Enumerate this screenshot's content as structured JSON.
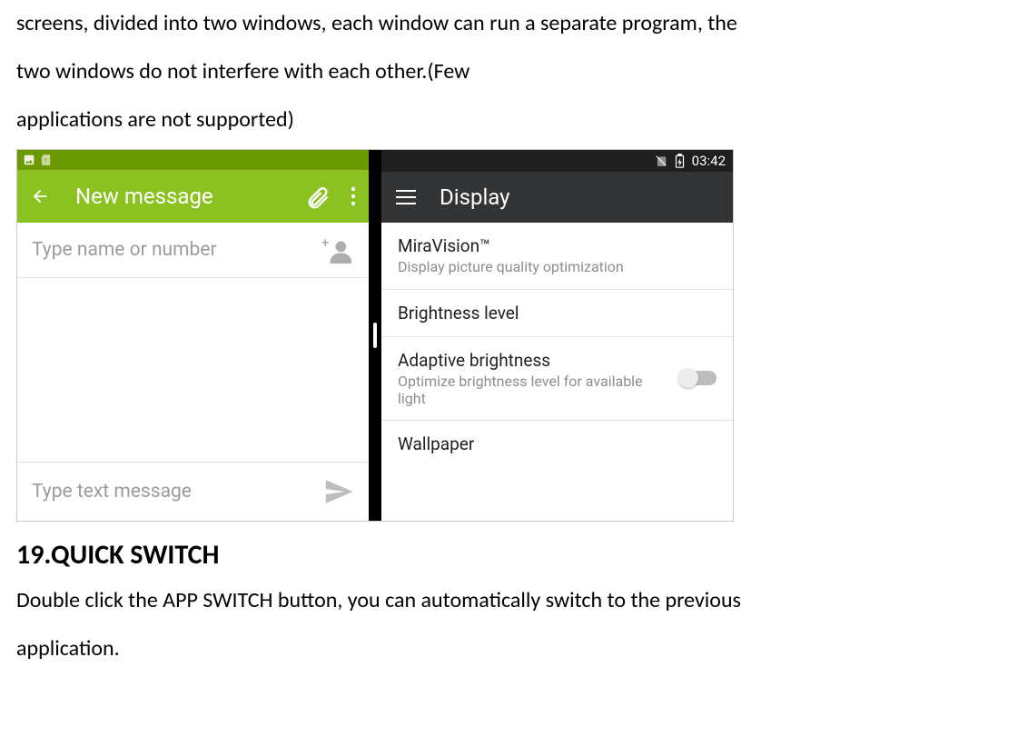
{
  "doc": {
    "intro_line1": "screens, divided into two windows, each window can run a separate program, the",
    "intro_line2": "two windows do not interfere with each other.(Few",
    "intro_line3": "applications are not supported)",
    "heading": "19.QUICK SWITCH",
    "para2_line1": "Double click the APP SWITCH button, you can automatically switch to the previous",
    "para2_line2": "application."
  },
  "left": {
    "title": "New message",
    "to_placeholder": "Type name or number",
    "compose_placeholder": "Type text message"
  },
  "right": {
    "clock": "03:42",
    "title": "Display",
    "items": [
      {
        "primary": "MiraVision™",
        "secondary": "Display picture quality optimization"
      },
      {
        "primary": "Brightness level",
        "secondary": ""
      },
      {
        "primary": "Adaptive brightness",
        "secondary": "Optimize brightness level for available light",
        "toggle": true
      },
      {
        "primary": "Wallpaper",
        "secondary": ""
      }
    ]
  }
}
